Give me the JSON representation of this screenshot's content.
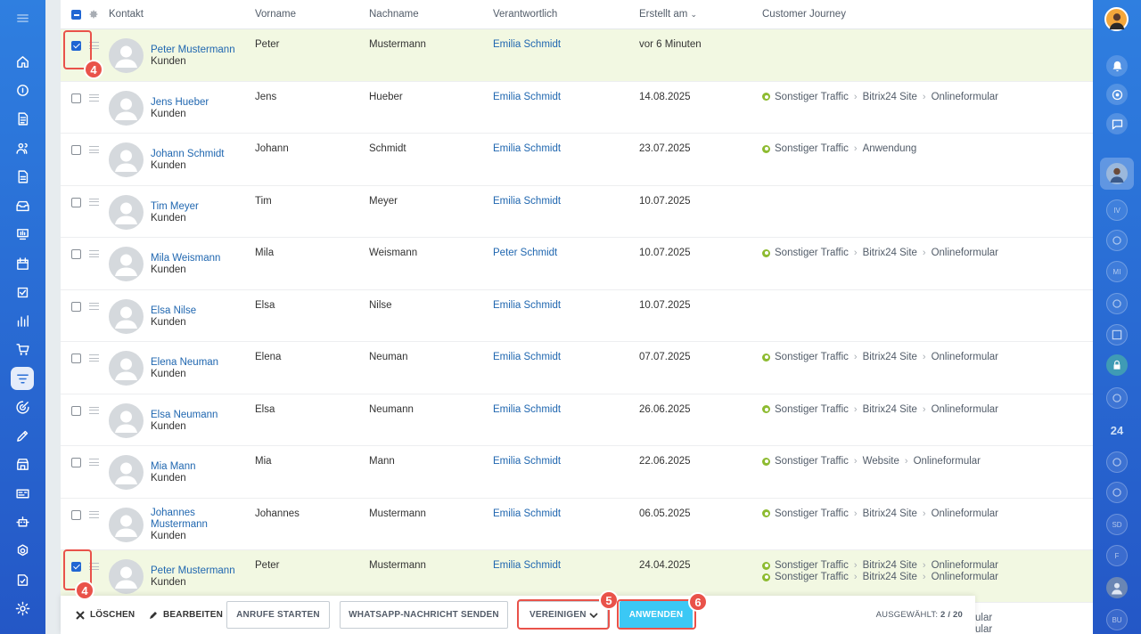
{
  "grid": {
    "columns": {
      "contact": "Kontakt",
      "first_name": "Vorname",
      "last_name": "Nachname",
      "responsible": "Verantwortlich",
      "created": "Erstellt am",
      "journey": "Customer Journey"
    },
    "rows": [
      {
        "name": "Peter Mustermann",
        "type": "Kunden",
        "first": "Peter",
        "last": "Mustermann",
        "resp": "Emilia Schmidt",
        "created": "vor 6 Minuten",
        "journey": [],
        "checked": true
      },
      {
        "name": "Jens Hueber",
        "type": "Kunden",
        "first": "Jens",
        "last": "Hueber",
        "resp": "Emilia Schmidt",
        "created": "14.08.2025",
        "journey": [
          [
            "Sonstiger Traffic",
            "Bitrix24 Site",
            "Onlineformular"
          ]
        ],
        "checked": false
      },
      {
        "name": "Johann Schmidt",
        "type": "Kunden",
        "first": "Johann",
        "last": "Schmidt",
        "resp": "Emilia Schmidt",
        "created": "23.07.2025",
        "journey": [
          [
            "Sonstiger Traffic",
            "Anwendung"
          ]
        ],
        "checked": false
      },
      {
        "name": "Tim Meyer",
        "type": "Kunden",
        "first": "Tim",
        "last": "Meyer",
        "resp": "Emilia Schmidt",
        "created": "10.07.2025",
        "journey": [],
        "checked": false
      },
      {
        "name": "Mila Weismann",
        "type": "Kunden",
        "first": "Mila",
        "last": "Weismann",
        "resp": "Peter Schmidt",
        "created": "10.07.2025",
        "journey": [
          [
            "Sonstiger Traffic",
            "Bitrix24 Site",
            "Onlineformular"
          ]
        ],
        "checked": false
      },
      {
        "name": "Elsa Nilse",
        "type": "Kunden",
        "first": "Elsa",
        "last": "Nilse",
        "resp": "Emilia Schmidt",
        "created": "10.07.2025",
        "journey": [],
        "checked": false
      },
      {
        "name": "Elena Neuman",
        "type": "Kunden",
        "first": "Elena",
        "last": "Neuman",
        "resp": "Emilia Schmidt",
        "created": "07.07.2025",
        "journey": [
          [
            "Sonstiger Traffic",
            "Bitrix24 Site",
            "Onlineformular"
          ]
        ],
        "checked": false
      },
      {
        "name": "Elsa Neumann",
        "type": "Kunden",
        "first": "Elsa",
        "last": "Neumann",
        "resp": "Emilia Schmidt",
        "created": "26.06.2025",
        "journey": [
          [
            "Sonstiger Traffic",
            "Bitrix24 Site",
            "Onlineformular"
          ]
        ],
        "checked": false
      },
      {
        "name": "Mia Mann",
        "type": "Kunden",
        "first": "Mia",
        "last": "Mann",
        "resp": "Emilia Schmidt",
        "created": "22.06.2025",
        "journey": [
          [
            "Sonstiger Traffic",
            "Website",
            "Onlineformular"
          ]
        ],
        "checked": false
      },
      {
        "name": "Johannes Mustermann",
        "type": "Kunden",
        "first": "Johannes",
        "last": "Mustermann",
        "resp": "Emilia Schmidt",
        "created": "06.05.2025",
        "journey": [
          [
            "Sonstiger Traffic",
            "Bitrix24 Site",
            "Onlineformular"
          ]
        ],
        "checked": false
      },
      {
        "name": "Peter Mustermann",
        "type": "Kunden",
        "first": "Peter",
        "last": "Mustermann",
        "resp": "Emilia Schmidt",
        "created": "24.04.2025",
        "journey": [
          [
            "Sonstiger Traffic",
            "Bitrix24 Site",
            "Onlineformular"
          ],
          [
            "Sonstiger Traffic",
            "Bitrix24 Site",
            "Onlineformular"
          ]
        ],
        "checked": true
      }
    ],
    "overflow_text": [
      "ular",
      "ular"
    ]
  },
  "action_bar": {
    "delete": "LÖSCHEN",
    "edit": "BEARBEITEN",
    "start_calls": "ANRUFE STARTEN",
    "whatsapp": "WHATSAPP-NACHRICHT SENDEN",
    "merge": "VEREINIGEN",
    "apply": "ANWENDEN",
    "selected_label": "AUSGEWÄHLT:",
    "selected_value": "2 / 20"
  },
  "markers": {
    "b4a": "4",
    "b4b": "4",
    "b5": "5",
    "b6": "6"
  },
  "right_bar": {
    "counter_24": "24",
    "initials": [
      "IV",
      "MI",
      "SD",
      "F",
      "BU"
    ]
  },
  "colors": {
    "sidebar": "#2a6fd6",
    "selected_row": "#f2f8e2",
    "link": "#2067b0",
    "apply_button": "#3bc8f5",
    "marker": "#e9524a",
    "journey_dot": "#8dbb30"
  },
  "icons": {
    "left": [
      "menu-icon",
      "home-icon",
      "chat-icon",
      "feed-icon",
      "contacts-icon",
      "document-icon",
      "inbox-icon",
      "chart-board-icon",
      "calendar-icon",
      "checkbox-icon",
      "analytics-icon",
      "cart-icon",
      "filter-icon",
      "target-icon",
      "pen-icon",
      "store-icon",
      "card-icon",
      "robot-icon",
      "settings-cog-icon",
      "sign-icon",
      "gear-icon"
    ]
  }
}
